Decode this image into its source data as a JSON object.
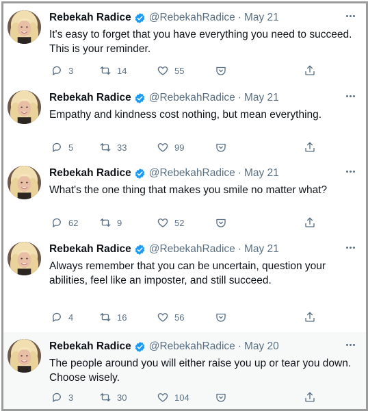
{
  "tweets": [
    {
      "name": "Rebekah Radice",
      "handle": "@RebekahRadice",
      "separator": "·",
      "date": "May 21",
      "text": "It's easy to forget that you have everything you need to succeed.\nThis is your reminder.",
      "replies": "3",
      "retweets": "14",
      "likes": "55"
    },
    {
      "name": "Rebekah Radice",
      "handle": "@RebekahRadice",
      "separator": "·",
      "date": "May 21",
      "text": "Empathy and kindness cost nothing, but mean everything.",
      "replies": "5",
      "retweets": "33",
      "likes": "99"
    },
    {
      "name": "Rebekah Radice",
      "handle": "@RebekahRadice",
      "separator": "·",
      "date": "May 21",
      "text": "What's the one thing that makes you smile no matter what?",
      "replies": "62",
      "retweets": "9",
      "likes": "52"
    },
    {
      "name": "Rebekah Radice",
      "handle": "@RebekahRadice",
      "separator": "·",
      "date": "May 21",
      "text": "Always remember that you can be uncertain, question your\nabilities, feel like an imposter, and still succeed.",
      "replies": "4",
      "retweets": "16",
      "likes": "56"
    },
    {
      "name": "Rebekah Radice",
      "handle": "@RebekahRadice",
      "separator": "·",
      "date": "May 20",
      "text": "The people around you will either raise you up or tear you down.\nChoose wisely.",
      "replies": "3",
      "retweets": "30",
      "likes": "104"
    }
  ],
  "icons": {
    "reply": "reply-icon",
    "retweet": "retweet-icon",
    "like": "like-icon",
    "analytics": "analytics-icon",
    "share": "share-icon",
    "more": "more-icon",
    "verified": "verified-badge-icon"
  },
  "colors": {
    "text": "#0f1419",
    "muted": "#5b7083",
    "verified": "#1d9bf0",
    "border": "#9c9c9c",
    "hover_bg": "#f7f9f9"
  }
}
